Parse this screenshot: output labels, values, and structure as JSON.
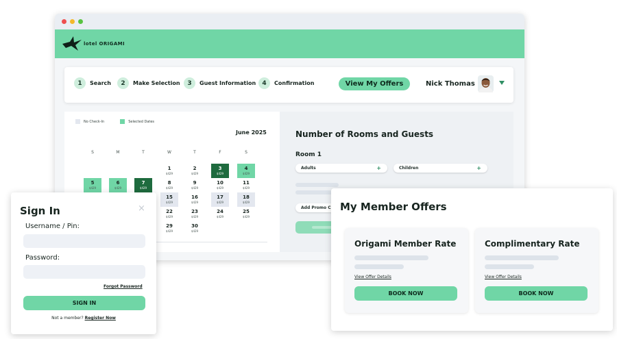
{
  "brand": {
    "logo_text": "lotel ORIGAMI"
  },
  "steps": [
    {
      "number": "1",
      "label": "Search"
    },
    {
      "number": "2",
      "label": "Make Selection"
    },
    {
      "number": "3",
      "label": "Guest Information"
    },
    {
      "number": "4",
      "label": "Confirmation"
    }
  ],
  "header": {
    "offers_button": "View My Offers",
    "user_name": "Nick Thomas"
  },
  "calendar": {
    "legend_no_checkin": "No Check-In",
    "legend_selected": "Selected Dates",
    "month": "June 2025",
    "weekdays": [
      "S",
      "M",
      "T",
      "W",
      "T",
      "F",
      "S"
    ],
    "days": [
      {
        "day": "1",
        "price": "$429",
        "state": "normal"
      },
      {
        "day": "2",
        "price": "$429",
        "state": "normal"
      },
      {
        "day": "3",
        "price": "$429",
        "state": "selected-end"
      },
      {
        "day": "4",
        "price": "$429",
        "state": "selected"
      },
      {
        "day": "5",
        "price": "$429",
        "state": "selected"
      },
      {
        "day": "6",
        "price": "$429",
        "state": "selected"
      },
      {
        "day": "7",
        "price": "$429",
        "state": "selected-end"
      },
      {
        "day": "8",
        "price": "$429",
        "state": "normal"
      },
      {
        "day": "9",
        "price": "$429",
        "state": "normal"
      },
      {
        "day": "10",
        "price": "$429",
        "state": "normal"
      },
      {
        "day": "11",
        "price": "$429",
        "state": "normal"
      },
      {
        "day": "15",
        "price": "$429",
        "state": "no-check-in"
      },
      {
        "day": "16",
        "price": "$429",
        "state": "normal"
      },
      {
        "day": "17",
        "price": "$429",
        "state": "no-check-in"
      },
      {
        "day": "18",
        "price": "$429",
        "state": "no-check-in"
      },
      {
        "day": "22",
        "price": "$429",
        "state": "normal"
      },
      {
        "day": "23",
        "price": "$429",
        "state": "normal"
      },
      {
        "day": "24",
        "price": "$429",
        "state": "normal"
      },
      {
        "day": "25",
        "price": "$429",
        "state": "normal"
      },
      {
        "day": "29",
        "price": "$429",
        "state": "normal"
      },
      {
        "day": "30",
        "price": "$429",
        "state": "normal"
      }
    ]
  },
  "rooms": {
    "title": "Number of Rooms and Guests",
    "room_label": "Room 1",
    "adults_label": "Adults",
    "children_label": "Children",
    "plus_symbol": "+",
    "promo_label": "Add Promo C"
  },
  "offers": {
    "title": "My Member Offers",
    "cards": [
      {
        "title": "Origami Member Rate",
        "link": "View Offer Details",
        "button": "BOOK NOW"
      },
      {
        "title": "Complimentary Rate",
        "link": "View Offer Details",
        "button": "BOOK NOW"
      }
    ]
  },
  "signin": {
    "title": "Sign In",
    "close_symbol": "×",
    "username_label": "Username / Pin:",
    "password_label": "Password:",
    "forgot_link": "Forgot Password",
    "button": "SIGN IN",
    "not_member_text": "Not a member?",
    "register_link": "Register Now"
  },
  "colors": {
    "accent_green": "#70d6a6",
    "dark_green": "#1e6b3e",
    "no_check_in": "#e3e7ef"
  },
  "icons": {
    "logo": "origami-crane-icon",
    "dropdown": "chevron-down-icon",
    "close": "close-icon",
    "plus": "plus-icon"
  }
}
